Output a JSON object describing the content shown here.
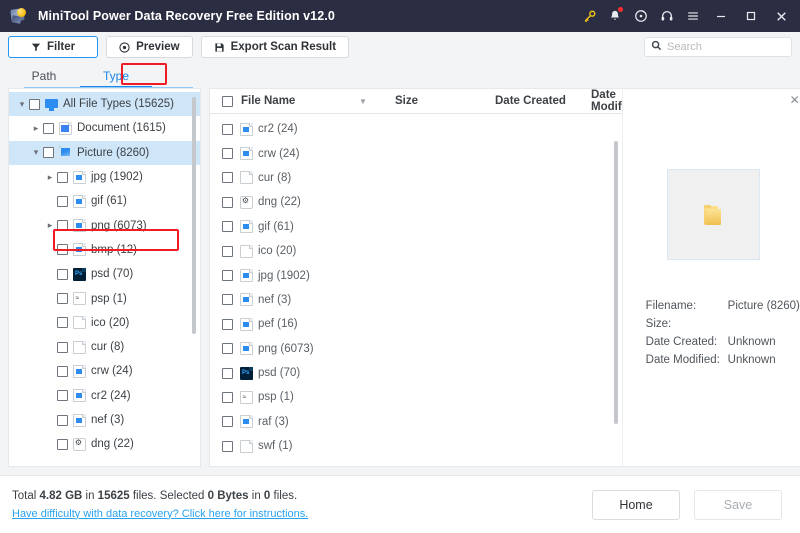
{
  "window": {
    "title": "MiniTool Power Data Recovery Free Edition v12.0",
    "icons": {
      "key": "key-icon",
      "bell": "bell-icon",
      "disc": "disc-icon",
      "headphones": "headphones-icon",
      "menu": "hamburger-menu-icon",
      "minimize": "minimize-icon",
      "maximize": "maximize-icon",
      "close": "close-icon"
    }
  },
  "toolbar": {
    "filter_label": "Filter",
    "preview_label": "Preview",
    "export_label": "Export Scan Result",
    "accent_color": "#2196f3"
  },
  "search": {
    "placeholder": "Search",
    "value": ""
  },
  "tabs": [
    {
      "label": "Path",
      "active": false
    },
    {
      "label": "Type",
      "active": true
    }
  ],
  "tree": [
    {
      "label": "All File Types (15625)",
      "indent": 0,
      "caret": "down",
      "icon": "monitor-icon",
      "selected": true
    },
    {
      "label": "Document (1615)",
      "indent": 1,
      "caret": "right",
      "icon": "document-icon",
      "selected": false
    },
    {
      "label": "Picture (8260)",
      "indent": 1,
      "caret": "down",
      "icon": "picture-icon",
      "selected": true
    },
    {
      "label": "jpg (1902)",
      "indent": 2,
      "caret": "right",
      "icon": "image-file-icon",
      "selected": false
    },
    {
      "label": "gif (61)",
      "indent": 2,
      "caret": "none",
      "icon": "image-file-icon",
      "selected": false
    },
    {
      "label": "png (6073)",
      "indent": 2,
      "caret": "right",
      "icon": "image-file-icon",
      "selected": false
    },
    {
      "label": "bmp (12)",
      "indent": 2,
      "caret": "none",
      "icon": "image-file-icon",
      "selected": false
    },
    {
      "label": "psd (70)",
      "indent": 2,
      "caret": "none",
      "icon": "psd-file-icon",
      "selected": false
    },
    {
      "label": "psp (1)",
      "indent": 2,
      "caret": "none",
      "icon": "psp-file-icon",
      "selected": false
    },
    {
      "label": "ico (20)",
      "indent": 2,
      "caret": "none",
      "icon": "plain-file-icon",
      "selected": false
    },
    {
      "label": "cur (8)",
      "indent": 2,
      "caret": "none",
      "icon": "plain-file-icon",
      "selected": false
    },
    {
      "label": "crw (24)",
      "indent": 2,
      "caret": "none",
      "icon": "image-file-icon",
      "selected": false
    },
    {
      "label": "cr2 (24)",
      "indent": 2,
      "caret": "none",
      "icon": "image-file-icon",
      "selected": false
    },
    {
      "label": "nef (3)",
      "indent": 2,
      "caret": "none",
      "icon": "image-file-icon",
      "selected": false
    },
    {
      "label": "dng (22)",
      "indent": 2,
      "caret": "none",
      "icon": "dng-file-icon",
      "selected": false
    }
  ],
  "list": {
    "columns": [
      "File Name",
      "Size",
      "Date Created",
      "Date Modif"
    ],
    "sort_icon": "sort-descending-icon",
    "rows": [
      {
        "name": "cr2 (24)",
        "icon": "image-file-icon",
        "size": "",
        "date_created": "",
        "date_modified": ""
      },
      {
        "name": "crw (24)",
        "icon": "image-file-icon",
        "size": "",
        "date_created": "",
        "date_modified": ""
      },
      {
        "name": "cur (8)",
        "icon": "plain-file-icon",
        "size": "",
        "date_created": "",
        "date_modified": ""
      },
      {
        "name": "dng (22)",
        "icon": "dng-file-icon",
        "size": "",
        "date_created": "",
        "date_modified": ""
      },
      {
        "name": "gif (61)",
        "icon": "image-file-icon",
        "size": "",
        "date_created": "",
        "date_modified": ""
      },
      {
        "name": "ico (20)",
        "icon": "plain-file-icon",
        "size": "",
        "date_created": "",
        "date_modified": ""
      },
      {
        "name": "jpg (1902)",
        "icon": "image-file-icon",
        "size": "",
        "date_created": "",
        "date_modified": ""
      },
      {
        "name": "nef (3)",
        "icon": "image-file-icon",
        "size": "",
        "date_created": "",
        "date_modified": ""
      },
      {
        "name": "pef (16)",
        "icon": "image-file-icon",
        "size": "",
        "date_created": "",
        "date_modified": ""
      },
      {
        "name": "png (6073)",
        "icon": "image-file-icon",
        "size": "",
        "date_created": "",
        "date_modified": ""
      },
      {
        "name": "psd (70)",
        "icon": "psd-file-icon",
        "size": "",
        "date_created": "",
        "date_modified": ""
      },
      {
        "name": "psp (1)",
        "icon": "psp-file-icon",
        "size": "",
        "date_created": "",
        "date_modified": ""
      },
      {
        "name": "raf (3)",
        "icon": "image-file-icon",
        "size": "",
        "date_created": "",
        "date_modified": ""
      },
      {
        "name": "swf (1)",
        "icon": "plain-file-icon",
        "size": "",
        "date_created": "",
        "date_modified": ""
      }
    ]
  },
  "preview": {
    "close_icon": "close-icon",
    "thumbnail_icon": "folder-icon",
    "fields": [
      {
        "key": "Filename:",
        "value": "Picture (8260)"
      },
      {
        "key": "Size:",
        "value": ""
      },
      {
        "key": "Date Created:",
        "value": "Unknown"
      },
      {
        "key": "Date Modified:",
        "value": "Unknown"
      }
    ]
  },
  "footer": {
    "status_total_prefix": "Total ",
    "status_total_size": "4.82 GB",
    "status_in": " in ",
    "status_total_files": "15625",
    "status_files_word": " files.  Selected ",
    "status_selected_size": "0 Bytes",
    "status_in2": " in ",
    "status_selected_files": "0",
    "status_end": " files.",
    "help_link": "Have difficulty with data recovery? Click here for instructions.",
    "link_color": "#29a3f0",
    "home_label": "Home",
    "save_label": "Save"
  },
  "annotations": {
    "color": "#ee1c25",
    "boxes": [
      "type-tab",
      "picture-tree-row"
    ]
  }
}
